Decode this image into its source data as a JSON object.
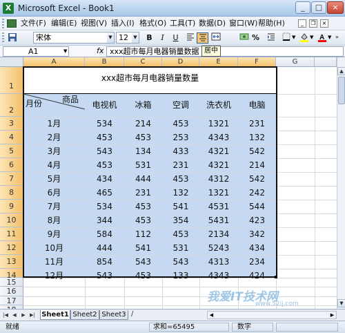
{
  "window": {
    "title": "Microsoft Excel - Book1",
    "icon": "excel-icon",
    "controls": [
      "_",
      "□",
      "×"
    ]
  },
  "menu": [
    "文件(F)",
    "编辑(E)",
    "视图(V)",
    "插入(I)",
    "格式(O)",
    "工具(T)",
    "数据(D)",
    "窗口(W)",
    "帮助(H)"
  ],
  "toolbar": {
    "font_name": "宋体",
    "font_size": "12",
    "bold": "B",
    "italic": "I",
    "underline": "U",
    "percent": "%",
    "icons": [
      "save-icon",
      "align-left-icon",
      "align-center-icon",
      "merge-center-icon",
      "currency-icon",
      "percent-icon",
      "indent-icon",
      "border-icon",
      "fill-color-icon",
      "font-color-icon"
    ],
    "fill_color": "#ffff00",
    "font_color": "#ff0000",
    "tooltip": "居中"
  },
  "formula_bar": {
    "name_box": "A1",
    "fx": "fx",
    "value": "xxx超市每月电器销量数据"
  },
  "grid": {
    "columns": [
      "A",
      "B",
      "C",
      "D",
      "E",
      "F",
      "G"
    ],
    "rows": [
      "1",
      "2",
      "3",
      "4",
      "5",
      "6",
      "7",
      "8",
      "9",
      "10",
      "11",
      "12",
      "13",
      "14",
      "15",
      "16",
      "17",
      "18"
    ],
    "title": "xxx超市每月电器销量数量",
    "corner_month": "月份",
    "corner_item": "商品",
    "headers": [
      "电视机",
      "冰箱",
      "空调",
      "洗衣机",
      "电脑"
    ],
    "data": [
      [
        "1月",
        "534",
        "214",
        "453",
        "1321",
        "231"
      ],
      [
        "2月",
        "453",
        "453",
        "253",
        "4343",
        "132"
      ],
      [
        "3月",
        "543",
        "134",
        "433",
        "4321",
        "542"
      ],
      [
        "4月",
        "453",
        "531",
        "231",
        "4321",
        "214"
      ],
      [
        "5月",
        "434",
        "444",
        "453",
        "4312",
        "542"
      ],
      [
        "6月",
        "465",
        "231",
        "132",
        "1321",
        "242"
      ],
      [
        "7月",
        "534",
        "453",
        "541",
        "4531",
        "544"
      ],
      [
        "8月",
        "344",
        "453",
        "354",
        "5431",
        "423"
      ],
      [
        "9月",
        "584",
        "112",
        "453",
        "2134",
        "342"
      ],
      [
        "10月",
        "444",
        "541",
        "531",
        "5243",
        "434"
      ],
      [
        "11月",
        "854",
        "543",
        "543",
        "4313",
        "234"
      ],
      [
        "12月",
        "543",
        "453",
        "133",
        "4343",
        "424"
      ]
    ],
    "selection_color": "#c5daf2"
  },
  "sheets": [
    "Sheet1",
    "Sheet2",
    "Sheet3"
  ],
  "status": {
    "ready": "就绪",
    "sum": "求和=65495",
    "num": "数字"
  },
  "watermark": {
    "text": "我爱IT技术网",
    "url": "www.52ij.com"
  }
}
